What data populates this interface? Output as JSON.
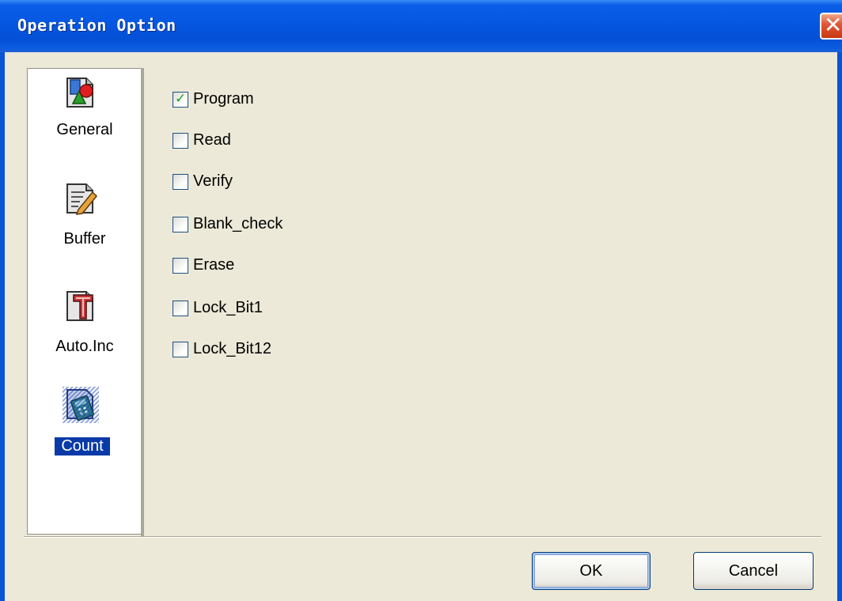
{
  "window": {
    "title": "Operation Option",
    "close_glyph": "✕"
  },
  "nav": {
    "items": [
      {
        "label": "General",
        "icon": "general-settings-icon",
        "selected": false
      },
      {
        "label": "Buffer",
        "icon": "buffer-edit-icon",
        "selected": false
      },
      {
        "label": "Auto.Inc",
        "icon": "auto-inc-icon",
        "selected": false
      },
      {
        "label": "Count",
        "icon": "count-icon",
        "selected": true
      }
    ]
  },
  "options": [
    {
      "label": "Program",
      "checked": true
    },
    {
      "label": "Read",
      "checked": false
    },
    {
      "label": "Verify",
      "checked": false
    },
    {
      "label": "Blank_check",
      "checked": false
    },
    {
      "label": "Erase",
      "checked": false
    },
    {
      "label": "Lock_Bit1",
      "checked": false
    },
    {
      "label": "Lock_Bit12",
      "checked": false
    }
  ],
  "buttons": {
    "ok": "OK",
    "cancel": "Cancel"
  },
  "colors": {
    "title_bar": "#0656e0",
    "dialog_bg": "#ece9d8",
    "selection": "#0a3aa8",
    "check_green": "#21a121"
  }
}
